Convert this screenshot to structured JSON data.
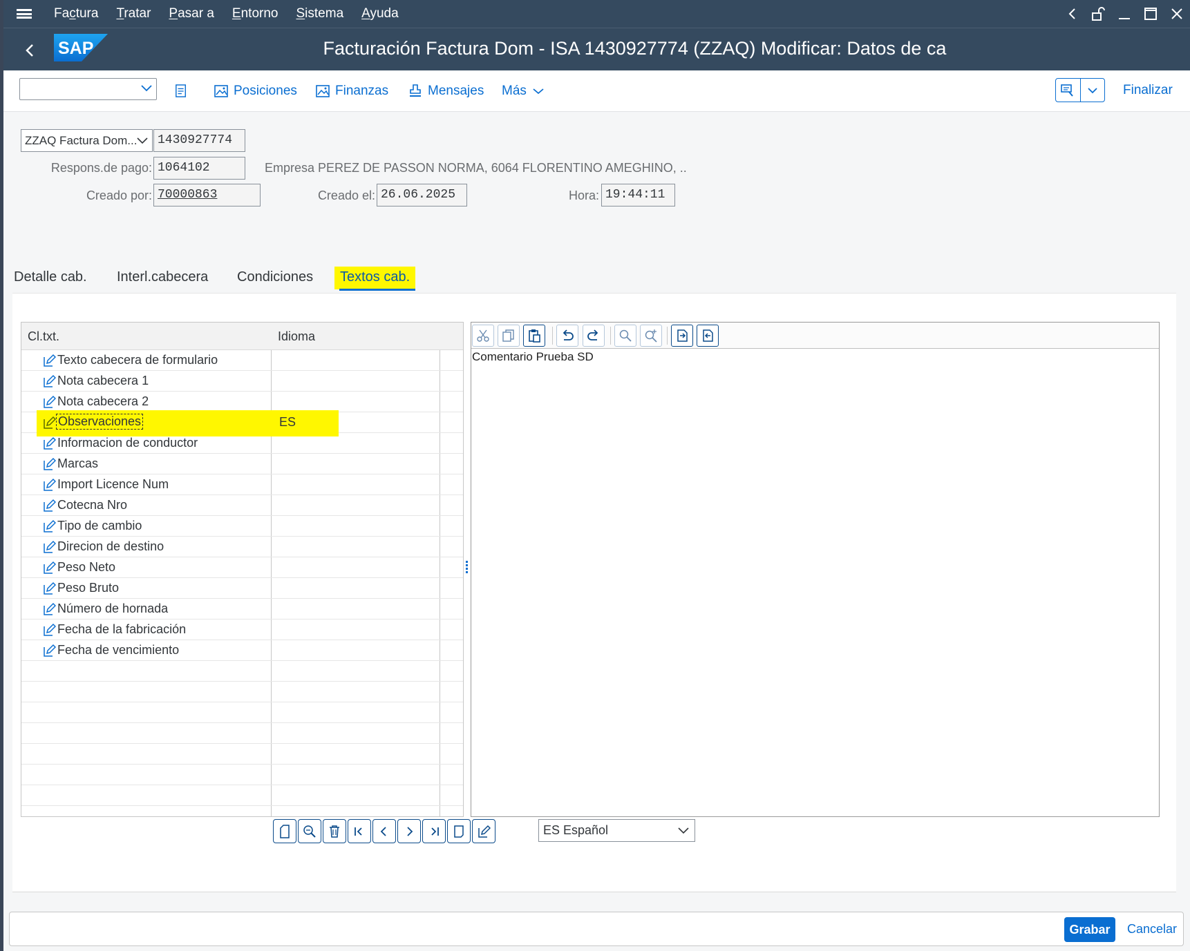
{
  "menu": {
    "items": [
      {
        "pre": "Fa",
        "u": "c",
        "post": "tura"
      },
      {
        "pre": "",
        "u": "T",
        "post": "ratar"
      },
      {
        "pre": "",
        "u": "P",
        "post": "asar a"
      },
      {
        "pre": "",
        "u": "E",
        "post": "ntorno"
      },
      {
        "pre": "",
        "u": "S",
        "post": "istema"
      },
      {
        "pre": "",
        "u": "A",
        "post": "yuda"
      }
    ]
  },
  "title": "Facturación Factura Dom - ISA 1430927774 (ZZAQ) Modificar: Datos de ca",
  "logo_text": "SAP",
  "toolbar": {
    "select_value": "",
    "posiciones": "Posiciones",
    "finanzas": "Finanzas",
    "mensajes": "Mensajes",
    "mas": "Más",
    "finalizar": "Finalizar"
  },
  "header": {
    "doc_type": "ZZAQ Factura Dom...",
    "doc_number": "1430927774",
    "payer_label": "Respons.de pago:",
    "payer_value": "1064102",
    "payer_desc": "Empresa PEREZ DE PASSON NORMA, 6064 FLORENTINO AMEGHINO, ..",
    "created_by_label": "Creado por:",
    "created_by_value": "70000863",
    "created_on_label": "Creado el:",
    "created_on_value": "26.06.2025",
    "time_label": "Hora:",
    "time_value": "19:44:11"
  },
  "tabs": [
    "Detalle cab.",
    "Interl.cabecera",
    "Condiciones",
    "Textos cab."
  ],
  "grid": {
    "col_text": "Cl.txt.",
    "col_lang": "Idioma",
    "rows": [
      {
        "label": "Texto cabecera de formulario",
        "lang": ""
      },
      {
        "label": "Nota cabecera 1",
        "lang": ""
      },
      {
        "label": "Nota cabecera 2",
        "lang": ""
      },
      {
        "label": "Observaciones",
        "lang": "ES"
      },
      {
        "label": "Informacion de conductor",
        "lang": ""
      },
      {
        "label": "Marcas",
        "lang": ""
      },
      {
        "label": "Import Licence Num",
        "lang": ""
      },
      {
        "label": "Cotecna Nro",
        "lang": ""
      },
      {
        "label": "Tipo de cambio",
        "lang": ""
      },
      {
        "label": "Direcion de destino",
        "lang": ""
      },
      {
        "label": "Peso Neto",
        "lang": ""
      },
      {
        "label": "Peso Bruto",
        "lang": ""
      },
      {
        "label": "Número de hornada",
        "lang": ""
      },
      {
        "label": "Fecha de la fabricación",
        "lang": ""
      },
      {
        "label": "Fecha de vencimiento",
        "lang": ""
      }
    ]
  },
  "editor": {
    "text": "Comentario Prueba SD"
  },
  "language_select": "ES Español",
  "footer": {
    "save": "Grabar",
    "cancel": "Cancelar"
  },
  "colors": {
    "shell": "#354a5f",
    "accent": "#0a6ed1",
    "highlight": "#fff700"
  }
}
